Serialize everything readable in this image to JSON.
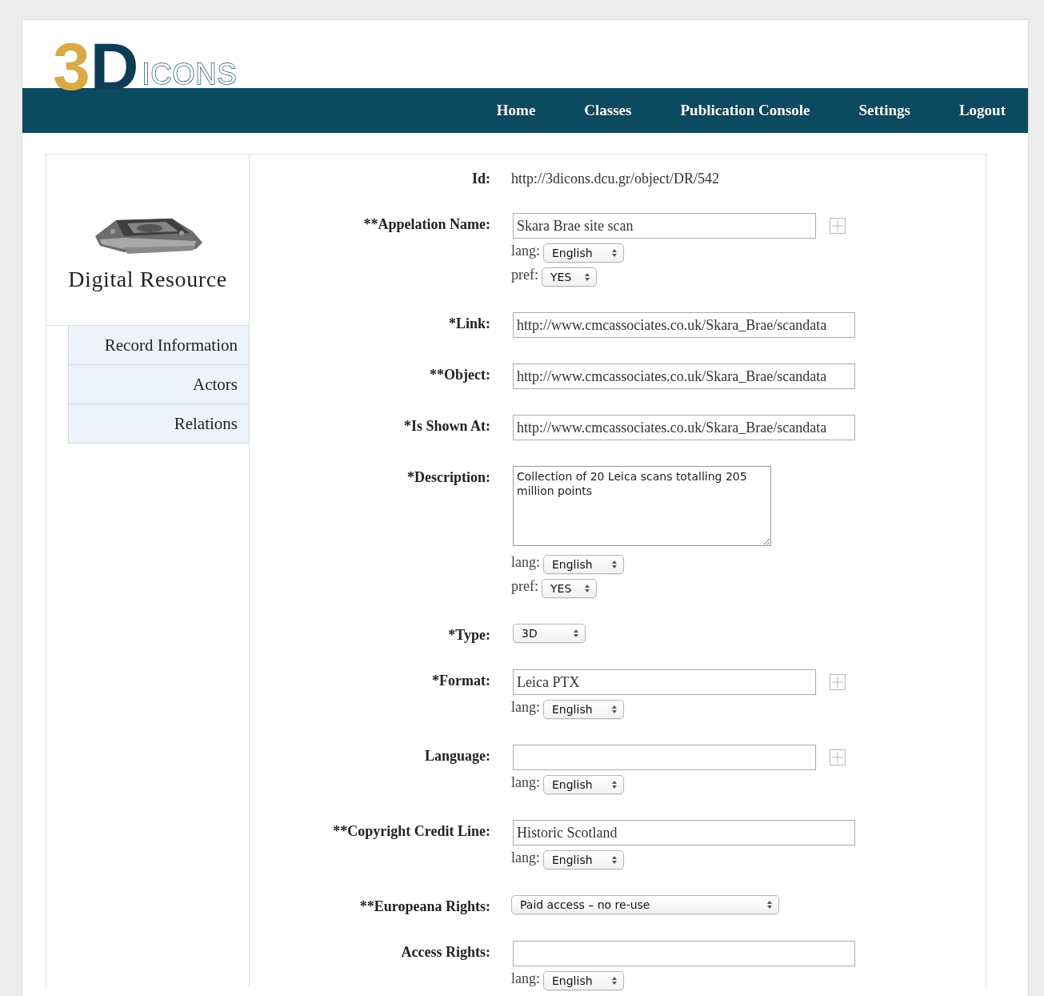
{
  "logo": {
    "mark": "3D",
    "word": "ICONS"
  },
  "nav": [
    "Home",
    "Classes",
    "Publication Console",
    "Settings",
    "Logout"
  ],
  "sidebar": {
    "title": "Digital Resource",
    "items": [
      "Record Information",
      "Actors",
      "Relations"
    ]
  },
  "fields": [
    {
      "label": "Id:",
      "kind": "static",
      "value": "http://3dicons.dcu.gr/object/DR/542"
    },
    {
      "label": "**Appelation Name:",
      "kind": "text",
      "value": "Skara Brae site scan",
      "addable": true,
      "lang": {
        "caption": "lang:",
        "value": "English"
      },
      "pref": {
        "caption": "pref:",
        "value": "YES"
      }
    },
    {
      "label": "*Link:",
      "kind": "text",
      "value": "http://www.cmcassociates.co.uk/Skara_Brae/scandata",
      "addable": false
    },
    {
      "label": "**Object:",
      "kind": "text",
      "value": "http://www.cmcassociates.co.uk/Skara_Brae/scandata",
      "addable": false
    },
    {
      "label": "*Is Shown At:",
      "kind": "text",
      "value": "http://www.cmcassociates.co.uk/Skara_Brae/scandata",
      "addable": false
    },
    {
      "label": "*Description:",
      "kind": "textarea",
      "value": "Collection of 20 Leica scans totalling 205 million points",
      "lang": {
        "caption": "lang:",
        "value": "English"
      },
      "pref": {
        "caption": "pref:",
        "value": "YES"
      }
    },
    {
      "label": "*Type:",
      "kind": "short-select",
      "value": "3D"
    },
    {
      "label": "*Format:",
      "kind": "text",
      "value": "Leica PTX",
      "addable": true,
      "lang": {
        "caption": "lang:",
        "value": "English"
      }
    },
    {
      "label": "Language:",
      "kind": "text",
      "addable": true,
      "lang": {
        "caption": "lang:",
        "value": "English"
      }
    },
    {
      "label": "**Copyright Credit Line:",
      "kind": "text",
      "value": "Historic Scotland",
      "addable": false,
      "lang": {
        "caption": "lang:",
        "value": "English"
      }
    },
    {
      "label": "**Europeana Rights:",
      "kind": "long-select",
      "value": "Paid access – no re-use"
    },
    {
      "label": "Access Rights:",
      "kind": "text",
      "addable": false,
      "lang": {
        "caption": "lang:",
        "value": "English"
      }
    }
  ]
}
